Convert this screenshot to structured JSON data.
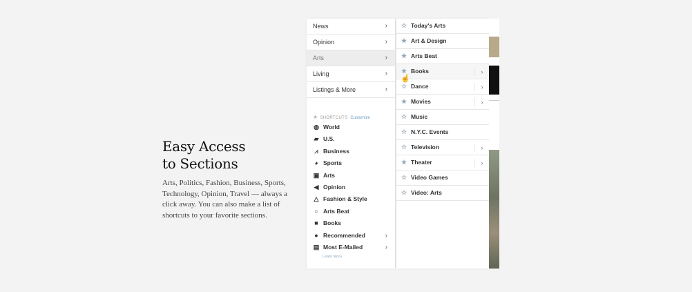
{
  "promo": {
    "title_line1": "Easy Access",
    "title_line2": "to Sections",
    "body": "Arts, Politics, Fashion, Business, Sports, Technology, Opinion, Travel — always a click away. You can also make a list of shortcuts to your favorite sections."
  },
  "nav": {
    "items": [
      {
        "label": "News"
      },
      {
        "label": "Opinion"
      },
      {
        "label": "Arts"
      },
      {
        "label": "Living"
      },
      {
        "label": "Listings & More"
      }
    ]
  },
  "shortcuts": {
    "header": "SHORTCUTS",
    "customize": "Customize",
    "items": [
      {
        "label": "World",
        "icon": "globe-icon"
      },
      {
        "label": "U.S.",
        "icon": "us-map-icon"
      },
      {
        "label": "Business",
        "icon": "chart-icon"
      },
      {
        "label": "Sports",
        "icon": "ball-icon"
      },
      {
        "label": "Arts",
        "icon": "frame-icon"
      },
      {
        "label": "Opinion",
        "icon": "megaphone-icon"
      },
      {
        "label": "Fashion & Style",
        "icon": "hanger-icon"
      },
      {
        "label": "Arts Beat",
        "icon": "circle-icon"
      },
      {
        "label": "Books",
        "icon": "book-icon"
      },
      {
        "label": "Recommended",
        "icon": "person-icon"
      },
      {
        "label": "Most E-Mailed",
        "icon": "mail-icon"
      }
    ],
    "learn_more": "Learn More"
  },
  "submenu": {
    "items": [
      {
        "label": "Today's Arts",
        "starred": false
      },
      {
        "label": "Art & Design",
        "starred": true
      },
      {
        "label": "Arts Beat",
        "starred": true
      },
      {
        "label": "Books",
        "starred": true
      },
      {
        "label": "Dance",
        "starred": false
      },
      {
        "label": "Movies",
        "starred": true
      },
      {
        "label": "Music",
        "starred": false
      },
      {
        "label": "N.Y.C. Events",
        "starred": false
      },
      {
        "label": "Television",
        "starred": false
      },
      {
        "label": "Theater",
        "starred": true
      },
      {
        "label": "Video Games",
        "starred": false
      },
      {
        "label": "Video: Arts",
        "starred": false
      }
    ]
  },
  "colors": {
    "background": "#f3f3f3",
    "star_filled": "#8fa6ba",
    "link": "#6a9bc5"
  }
}
